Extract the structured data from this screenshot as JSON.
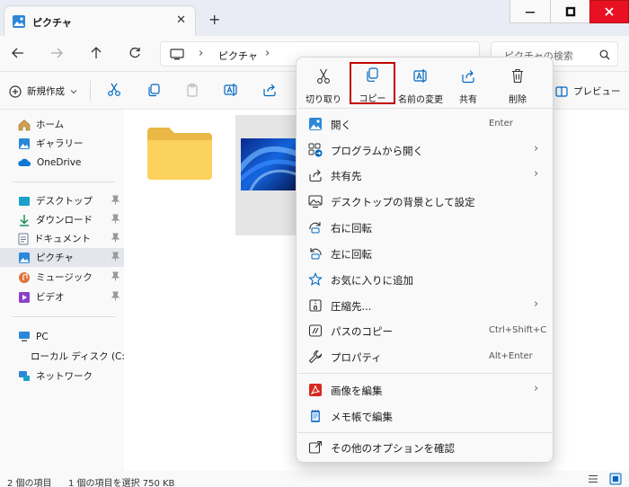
{
  "window": {
    "tab_title": "ピクチャ",
    "new_tab": "+",
    "tab_close": "✕"
  },
  "address": {
    "crumb": "ピクチャ",
    "search_placeholder": "ピクチャの検索"
  },
  "command_bar": {
    "new_label": "新規作成",
    "preview_label": "プレビュー"
  },
  "sidebar": {
    "home": "ホーム",
    "gallery": "ギャラリー",
    "onedrive": "OneDrive",
    "desktop": "デスクトップ",
    "downloads": "ダウンロード",
    "documents": "ドキュメント",
    "pictures": "ピクチャ",
    "music": "ミュージック",
    "videos": "ビデオ",
    "pc": "PC",
    "local_disk": "ローカル ディスク (C:)",
    "network": "ネットワーク"
  },
  "status": {
    "count": "2 個の項目",
    "selection": "1 個の項目を選択  750 KB"
  },
  "context_menu": {
    "quick_actions": {
      "cut": "切り取り",
      "copy": "コピー",
      "rename": "名前の変更",
      "share": "共有",
      "delete": "削除"
    },
    "items": {
      "open": {
        "label": "開く",
        "shortcut": "Enter"
      },
      "open_with": {
        "label": "プログラムから開く"
      },
      "share_with": {
        "label": "共有先"
      },
      "set_background": {
        "label": "デスクトップの背景として設定"
      },
      "rotate_right": {
        "label": "右に回転"
      },
      "rotate_left": {
        "label": "左に回転"
      },
      "add_favorites": {
        "label": "お気に入りに追加"
      },
      "compress": {
        "label": "圧縮先..."
      },
      "copy_path": {
        "label": "パスのコピー",
        "shortcut": "Ctrl+Shift+C"
      },
      "properties": {
        "label": "プロパティ",
        "shortcut": "Alt+Enter"
      },
      "edit_image": {
        "label": "画像を編集"
      },
      "edit_notepad": {
        "label": "メモ帳で編集"
      },
      "more_options": {
        "label": "その他のオプションを確認"
      }
    }
  },
  "colors": {
    "accent": "#0067c0",
    "highlight_outline": "#c00000",
    "close_button": "#e81123"
  }
}
